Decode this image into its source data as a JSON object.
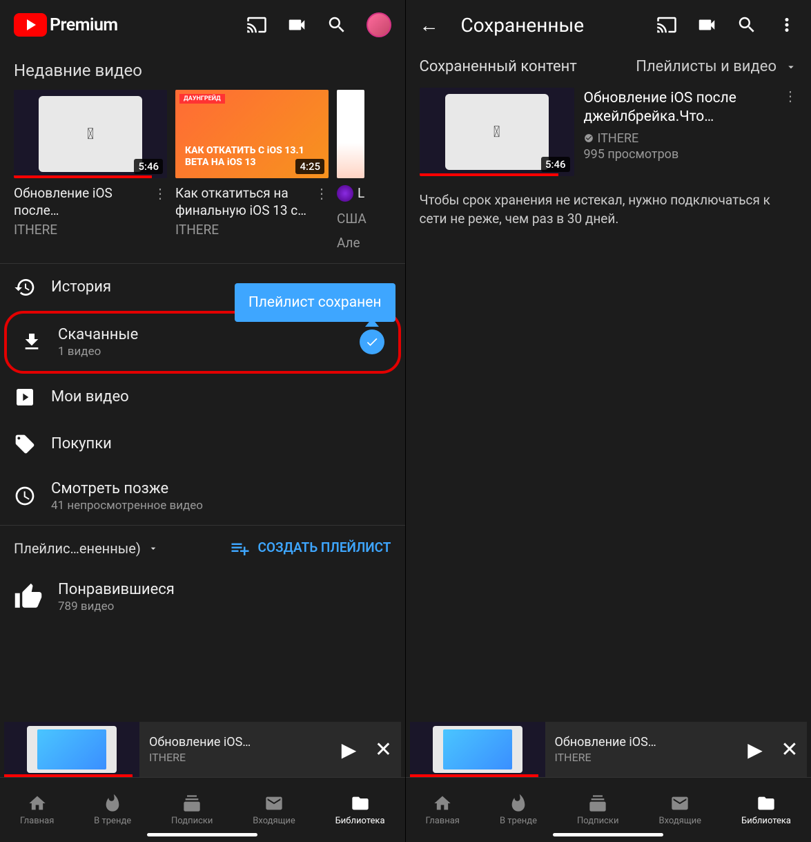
{
  "left": {
    "header": {
      "premium": "Premium"
    },
    "section_title": "Недавние видео",
    "videos": [
      {
        "title": "Обновление iOS после…",
        "channel": "ITHERE",
        "duration": "5:46",
        "progress": 90
      },
      {
        "title": "Как откатиться на финальную iOS 13 с…",
        "channel": "ITHERE",
        "duration": "4:25",
        "progress": 0,
        "badge": "ДАУНГРЕЙД",
        "overlay": "КАК ОТКАТИТЬ С iOS 13.1 BETA НА iOS 13"
      },
      {
        "title": "L",
        "channel": "США",
        "channel2": "Але",
        "duration": "",
        "progress": 0
      }
    ],
    "menu": {
      "history": "История",
      "downloads": {
        "label": "Скачанные",
        "sub": "1 видео"
      },
      "my_videos": "Мои видео",
      "purchases": "Покупки",
      "watch_later": {
        "label": "Смотреть позже",
        "sub": "41 непросмотренное видео"
      }
    },
    "toast": "Плейлист сохранен",
    "playlists": {
      "label": "Плейлис…ененные)",
      "create": "СОЗДАТЬ ПЛЕЙЛИСТ",
      "liked": {
        "label": "Понравившиеся",
        "sub": "789 видео"
      }
    }
  },
  "right": {
    "title": "Сохраненные",
    "filter_label": "Сохраненный контент",
    "filter_select": "Плейлисты и видео",
    "video": {
      "title": "Обновление iOS после джейлбрейка.Что…",
      "channel": "ITHERE",
      "views": "995 просмотров",
      "duration": "5:46",
      "progress": 90
    },
    "note": "Чтобы срок хранения не истекал, нужно подключаться к сети не реже, чем раз в 30 дней."
  },
  "mini_player": {
    "title": "Обновление iOS…",
    "channel": "ITHERE"
  },
  "nav": {
    "home": "Главная",
    "trending": "В тренде",
    "subs": "Подписки",
    "inbox": "Входящие",
    "library": "Библиотека"
  }
}
